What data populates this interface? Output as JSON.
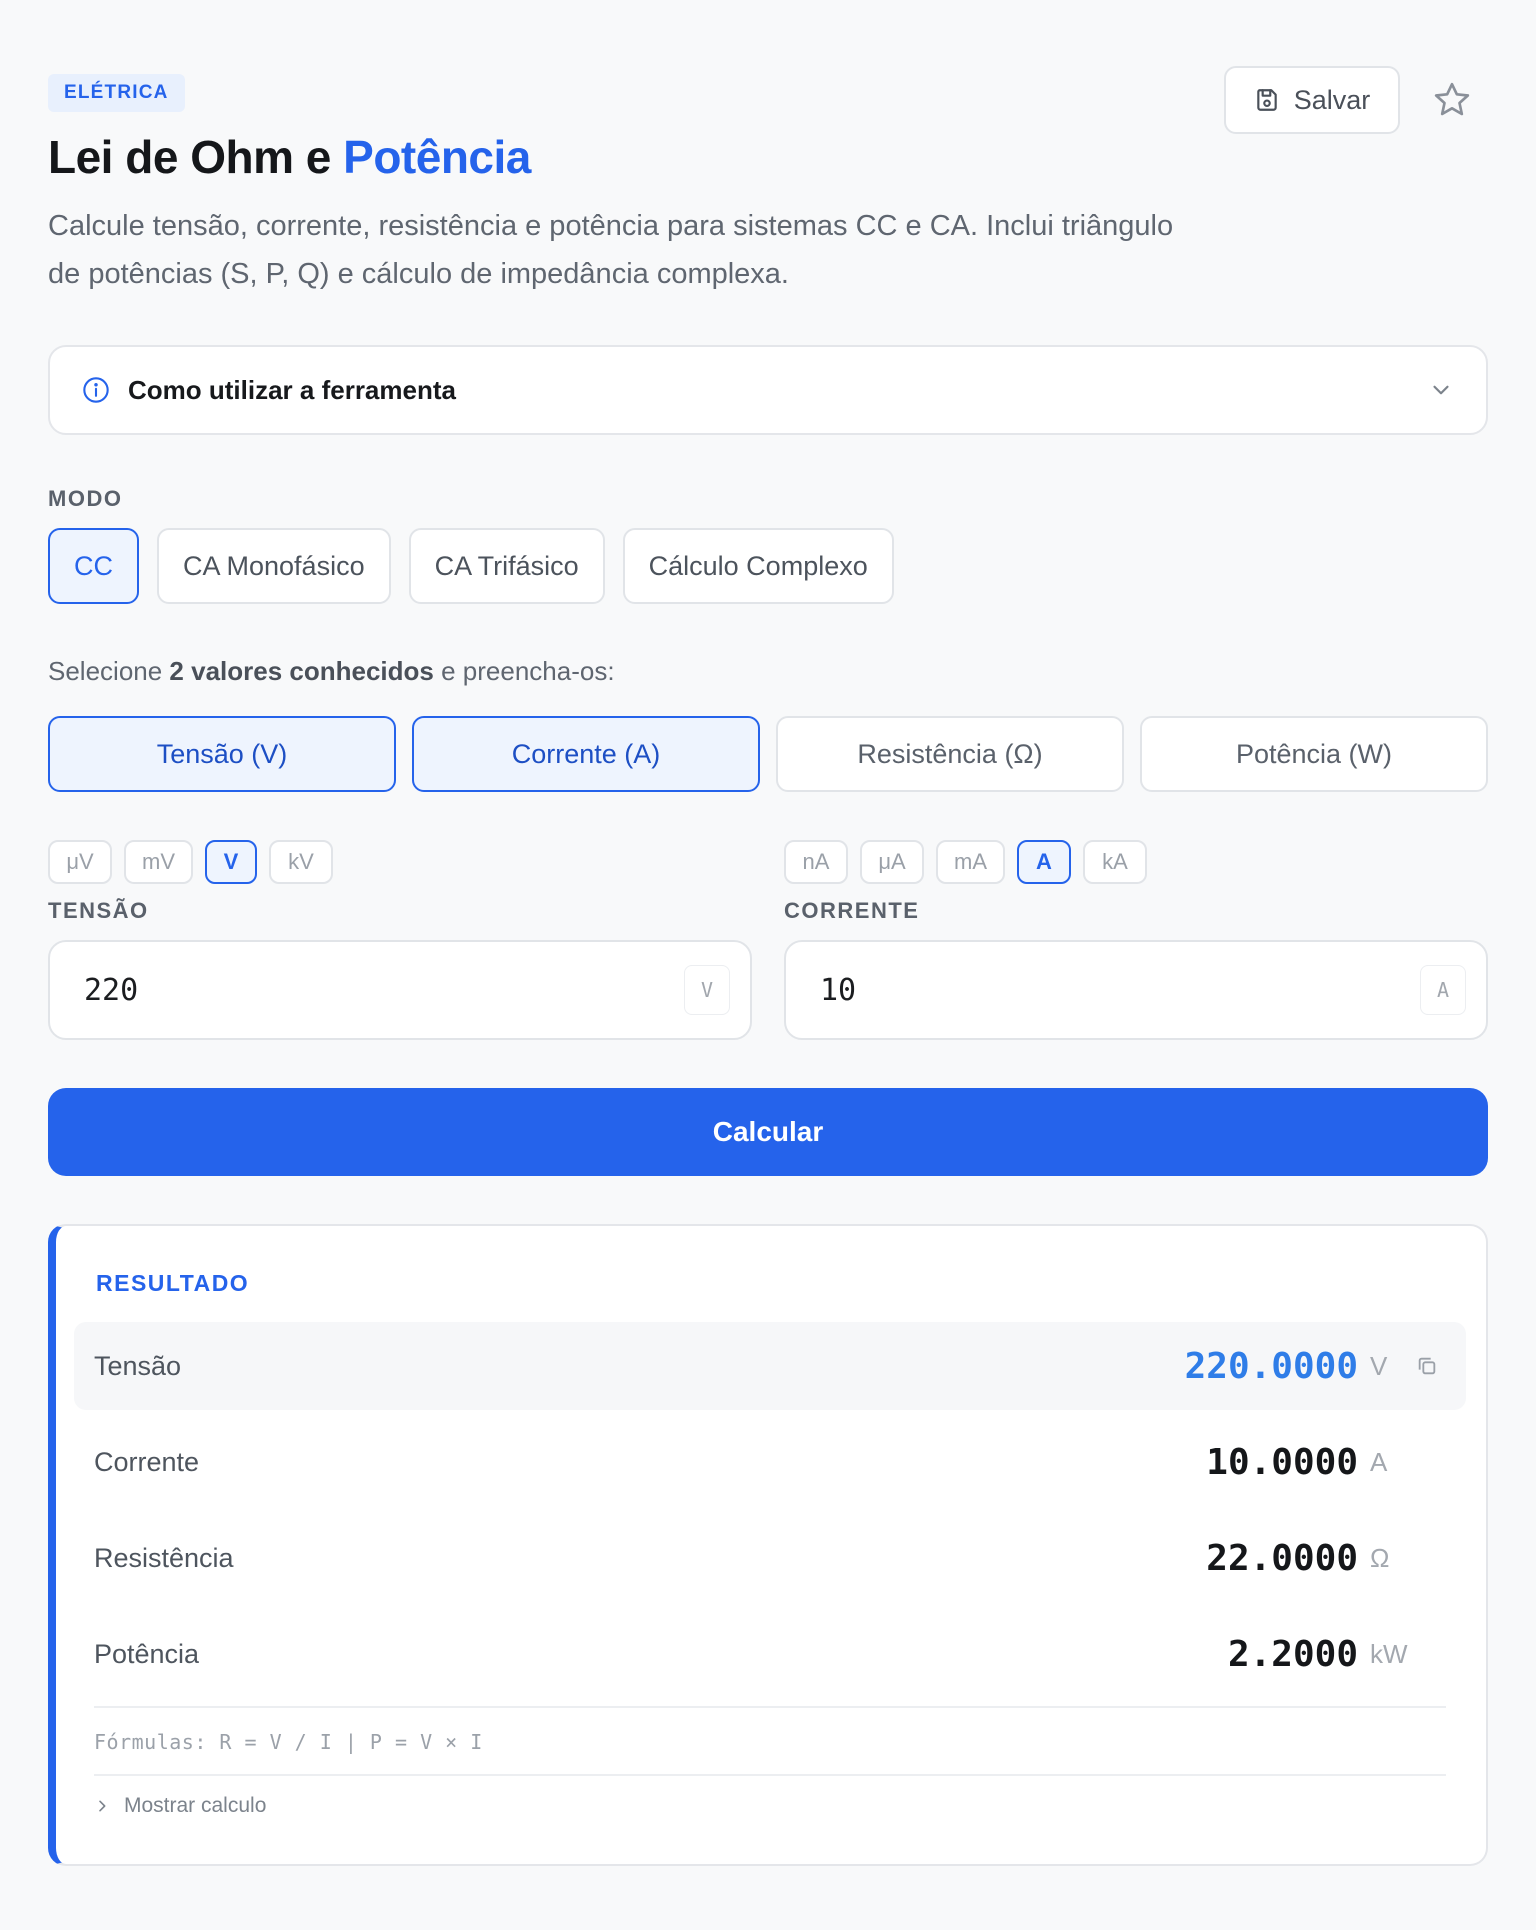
{
  "header": {
    "badge": "ELÉTRICA",
    "title_main": "Lei de Ohm e ",
    "title_accent": "Potência",
    "subtitle": "Calcule tensão, corrente, resistência e potência para sistemas CC e CA. Inclui triângulo de potências (S, P, Q) e cálculo de impedância complexa.",
    "save_label": "Salvar"
  },
  "howto": {
    "label": "Como utilizar a ferramenta"
  },
  "mode": {
    "label": "MODO",
    "options": [
      "CC",
      "CA Monofásico",
      "CA Trifásico",
      "Cálculo Complexo"
    ],
    "selected": "CC"
  },
  "select": {
    "prefix": "Selecione ",
    "bold": "2 valores conhecidos",
    "suffix": " e preencha-os:",
    "options": [
      "Tensão (V)",
      "Corrente (A)",
      "Resistência (Ω)",
      "Potência (W)"
    ]
  },
  "voltage": {
    "units": [
      "μV",
      "mV",
      "V",
      "kV"
    ],
    "selected_unit": "V",
    "label": "TENSÃO",
    "value": "220",
    "suffix": "V"
  },
  "current": {
    "units": [
      "nA",
      "μA",
      "mA",
      "A",
      "kA"
    ],
    "selected_unit": "A",
    "label": "CORRENTE",
    "value": "10",
    "suffix": "A"
  },
  "calculate_label": "Calcular",
  "result": {
    "title": "RESULTADO",
    "rows": [
      {
        "label": "Tensão",
        "value": "220.0000",
        "unit": "V"
      },
      {
        "label": "Corrente",
        "value": "10.0000",
        "unit": "A"
      },
      {
        "label": "Resistência",
        "value": "22.0000",
        "unit": "Ω"
      },
      {
        "label": "Potência",
        "value": "2.2000",
        "unit": "kW"
      }
    ],
    "formula": "Fórmulas: R = V / I | P = V × I",
    "show_calc": "Mostrar calculo"
  },
  "colors": {
    "accent": "#2563eb",
    "background": "#f8f9fa"
  }
}
